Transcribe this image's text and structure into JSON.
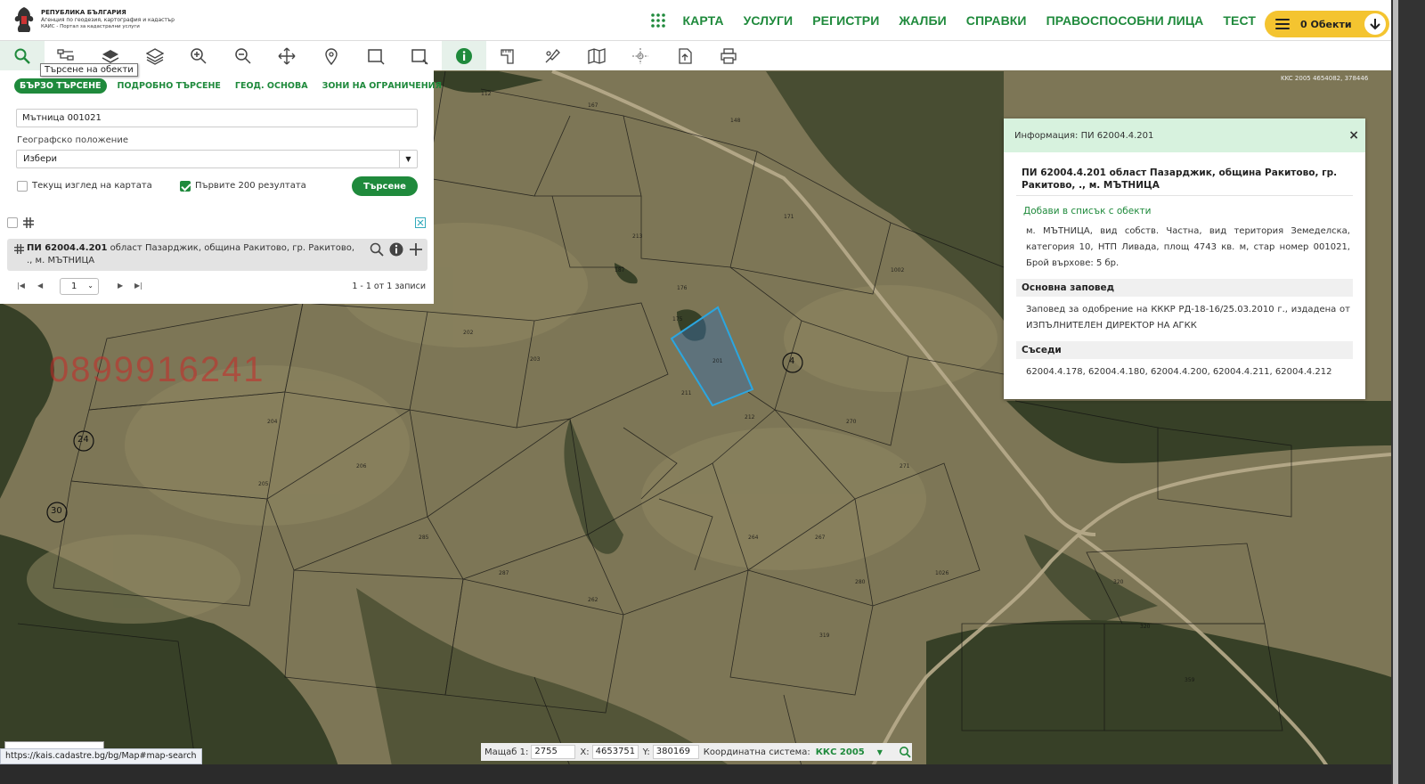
{
  "header": {
    "logo_line1": "РЕПУБЛИКА БЪЛГАРИЯ",
    "logo_line2": "Агенция по геодезия, картография и кадастър",
    "logo_line3": "КАИС - Портал за кадастрални услуги",
    "nav": [
      "КАРТА",
      "УСЛУГИ",
      "РЕГИСТРИ",
      "ЖАЛБИ",
      "СПРАВКИ",
      "ПРАВОСПОСОБНИ ЛИЦА",
      "ТЕСТ"
    ],
    "objects_label": "0 Обекти"
  },
  "toolbar": {
    "tooltip": "Търсене на обекти",
    "icons": [
      "search-icon",
      "tree-icon",
      "layers-filled-icon",
      "layers-icon",
      "zoom-in-icon",
      "zoom-out-icon",
      "pan-icon",
      "location-pin-icon",
      "rectangle-select-icon",
      "polygon-select-icon",
      "info-icon",
      "measure-icon",
      "draw-icon",
      "map-icon",
      "coordinates-icon",
      "export-icon",
      "print-icon"
    ]
  },
  "search": {
    "tabs": [
      "БЪРЗО ТЪРСЕНЕ",
      "ПОДРОБНО ТЪРСЕНЕ",
      "ГЕОД. ОСНОВА",
      "ЗОНИ НА ОГРАНИЧЕНИЯ"
    ],
    "query": "Мътница 001021",
    "geo_label": "Географско положение",
    "geo_value": "Избери",
    "current_view_label": "Текущ изглед на картата",
    "first200_label": "Първите 200 резултата",
    "search_button": "Търсене",
    "result_bold": "ПИ 62004.4.201",
    "result_text": " област Пазарджик, община Ракитово, гр. Ракитово, ., м. МЪТНИЦА",
    "page": "1",
    "records": "1 - 1 от 1 записи"
  },
  "info": {
    "header": "Информация: ПИ 62004.4.201",
    "title": "ПИ 62004.4.201 област Пазарджик, община Ракитово, гр. Ракитово, ., м. МЪТНИЦА",
    "add_link": "Добави в списък с обекти",
    "description": "м. МЪТНИЦА, вид собств. Частна, вид територия Земеделска, категория 10, НТП Ливада, площ 4743 кв. м, стар номер 001021, Брой върхове: 5 бр.",
    "order_heading": "Основна заповед",
    "order_text": "Заповед за одобрение на КККР РД-18-16/25.03.2010 г., издадена от ИЗПЪЛНИТЕЛЕН ДИРЕКТОР НА АГКК",
    "neighbors_heading": "Съседи",
    "neighbors": "62004.4.178, 62004.4.180, 62004.4.200, 62004.4.211, 62004.4.212"
  },
  "map": {
    "watermark": "0899916241",
    "corner_coords": "KKC 2005 4654082, 378446",
    "circle_labels": [
      "4",
      "24",
      "30"
    ],
    "highlight_color": "#2ba6e0",
    "parcel_labels": [
      "112",
      "167",
      "148",
      "171",
      "176",
      "175",
      "201",
      "211",
      "212",
      "213",
      "187",
      "202",
      "203",
      "204",
      "205",
      "206",
      "285",
      "287",
      "262",
      "264",
      "267",
      "270",
      "271",
      "280",
      "319",
      "320",
      "320",
      "359",
      "1026",
      "1002"
    ]
  },
  "status": {
    "url": "https://kais.cadastre.bg/bg/Map#map-search",
    "scale_label": "Мащаб 1:",
    "scale_value": "2755",
    "x_label": "X:",
    "x_value": "4653751",
    "y_label": "Y:",
    "y_value": "380169",
    "crs_label": "Координатна система:",
    "crs_value": "ККС 2005"
  }
}
